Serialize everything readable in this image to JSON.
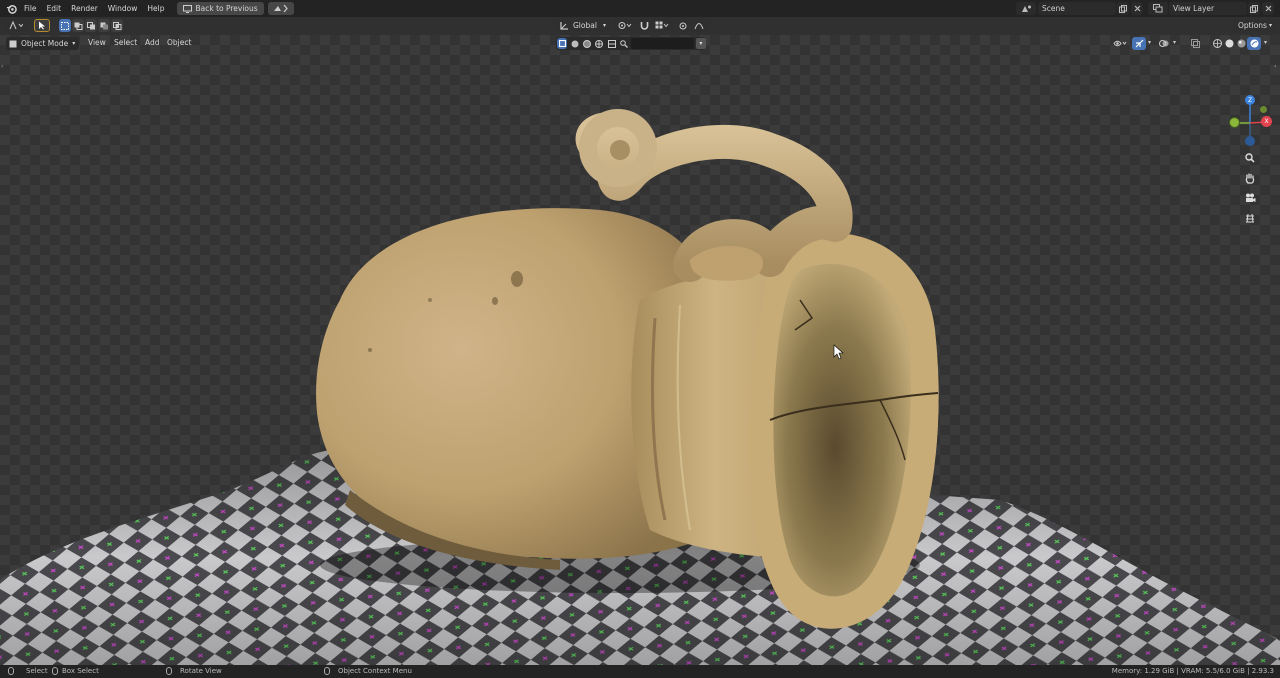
{
  "topbar": {
    "menus": [
      "File",
      "Edit",
      "Render",
      "Window",
      "Help"
    ],
    "back_label": "Back to Previous",
    "scene_label": "Scene",
    "view_layer_label": "View Layer"
  },
  "tool_header": {
    "transform_orientation": "Global",
    "options_label": "Options"
  },
  "viewport_header": {
    "mode_label": "Object Mode",
    "menus": [
      "View",
      "Select",
      "Add",
      "Object"
    ]
  },
  "gizmo": {
    "z_label": "Z",
    "y_label": "Y",
    "x_label": "X"
  },
  "statusbar": {
    "select": "Select",
    "box_select": "Box Select",
    "rotate_view": "Rotate View",
    "context_menu": "Object Context Menu",
    "memory": "Memory: 1.29 GiB | VRAM: 5.5/6.0 GiB | 2.93.3"
  },
  "colors": {
    "accent": "#4772b3",
    "axis_x": "#e2434e",
    "axis_y": "#8bb73a",
    "axis_z": "#3c83dd"
  }
}
